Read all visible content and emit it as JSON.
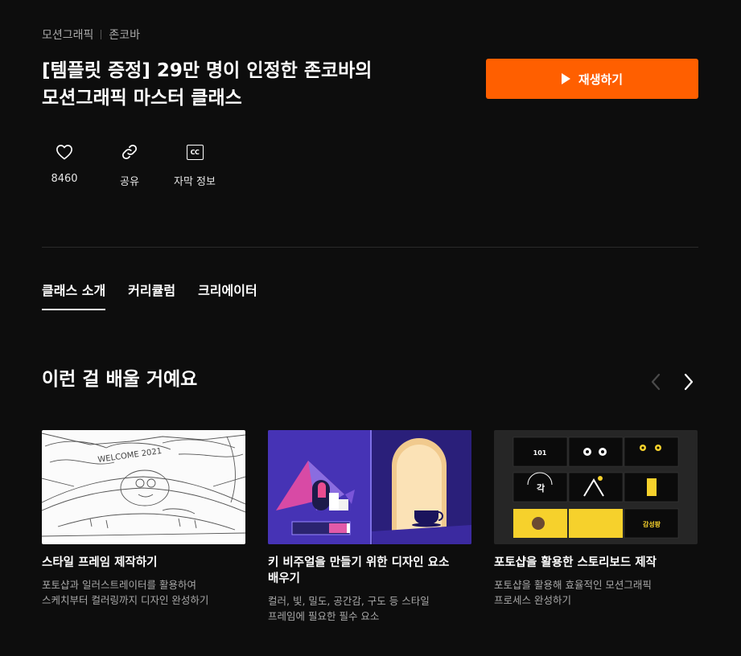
{
  "breadcrumb": {
    "category": "모션그래픽",
    "creator": "존코바"
  },
  "title": {
    "line1": "[템플릿 증정] 29만 명이 인정한 존코바의",
    "line2": "모션그래픽 마스터 클래스"
  },
  "play_button": {
    "label": "재생하기",
    "icon": "play-icon"
  },
  "actions": {
    "like": {
      "count": "8460",
      "icon": "heart-icon"
    },
    "share": {
      "label": "공유",
      "icon": "link-icon"
    },
    "subtitles": {
      "label": "자막 정보",
      "icon": "cc-icon",
      "badge": "CC"
    }
  },
  "tabs": [
    {
      "label": "클래스 소개",
      "active": true
    },
    {
      "label": "커리큘럼",
      "active": false
    },
    {
      "label": "크리에이터",
      "active": false
    }
  ],
  "section": {
    "title": "이런 걸 배울 거예요"
  },
  "cards": [
    {
      "title": "스타일 프레임 제작하기",
      "description": "포토샵과 일러스트레이터를 활용하여\n스케치부터 컬러링까지 디자인 완성하기",
      "thumb_text": "WELCOME 2021"
    },
    {
      "title": "키 비주얼을 만들기 위한 디자인 요소\n배우기",
      "description": "컬러, 빛, 밀도, 공간감, 구도 등 스타일\n프레임에 필요한 필수 요소"
    },
    {
      "title": "포토샵을 활용한 스토리보드 제작",
      "description": "포토샵을 활용해 효율적인 모션그래픽\n프로세스 완성하기",
      "thumb_text": [
        "101",
        "각",
        "감성팡"
      ]
    }
  ],
  "colors": {
    "accent": "#ff5f00",
    "background": "#0d0d0d",
    "muted_text": "#a8a8a8"
  }
}
